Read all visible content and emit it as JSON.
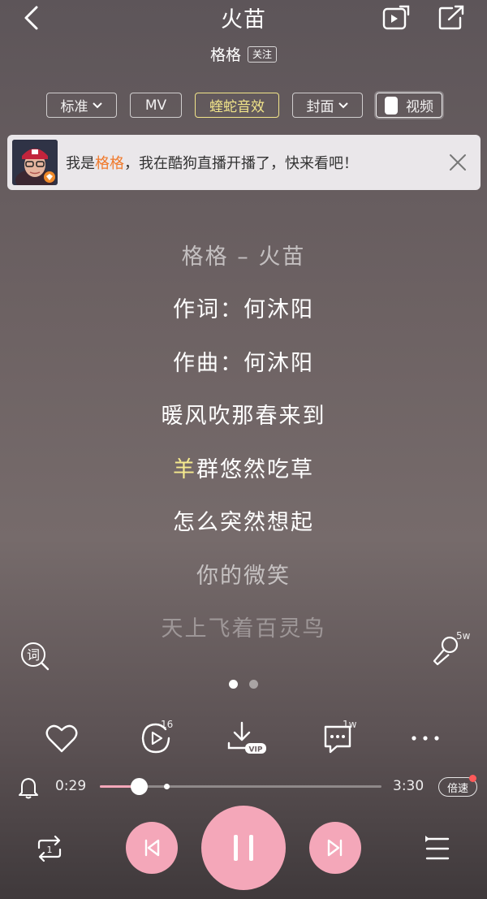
{
  "header": {
    "title": "火苗",
    "artist": "格格",
    "follow_label": "关注"
  },
  "options": {
    "quality_label": "标准",
    "mv_label": "MV",
    "sound_effect_label": "蝰蛇音效",
    "cover_label": "封面",
    "video_label": "视频"
  },
  "banner": {
    "prefix": "我是",
    "name": "格格",
    "suffix": "，我在酷狗直播开播了，快来看吧！"
  },
  "lyrics": {
    "lines": [
      "格格 – 火苗",
      "作词：何沐阳",
      "作曲：何沐阳",
      "暖风吹那春来到",
      "羊群悠然吃草",
      "怎么突然想起",
      "你的微笑",
      "天上飞着百灵鸟"
    ],
    "current_line": {
      "sung": "羊",
      "unsung": "群悠然吃草"
    },
    "progress_fraction_of_current": 0.17
  },
  "side": {
    "lyrics_icon_label": "词",
    "sing_count": "5w"
  },
  "pager": {
    "pages": 2,
    "active": 0
  },
  "actions": {
    "share_count": "16",
    "download_badge": "VIP",
    "comment_count": "1w"
  },
  "playback": {
    "current_time": "0:29",
    "total_time": "3:30",
    "progress": 0.138,
    "speed_label": "倍速",
    "repeat_badge": "1"
  },
  "colors": {
    "accent_pink": "#f4a7b9",
    "lyric_highlight": "#f6ea8e",
    "sound_effect": "#f2e58a",
    "banner_highlight": "#f07a2c"
  }
}
